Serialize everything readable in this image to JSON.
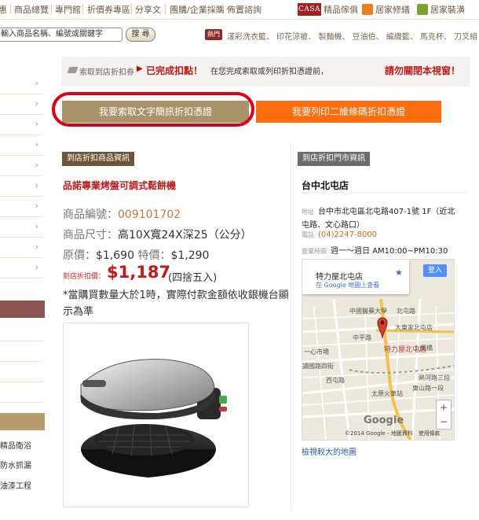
{
  "top_nav": {
    "items": [
      "惠",
      "商品總覽",
      "專門館",
      "折價券專區",
      "分享文",
      "團購/企業採購",
      "佈置諮詢"
    ],
    "right_links": [
      {
        "badge": "CASA",
        "label": "精品傢俱"
      },
      {
        "label": "居家修繕",
        "color": "#f07c1a"
      },
      {
        "label": "居家裝潢",
        "color": "#7aa332"
      }
    ]
  },
  "search": {
    "placeholder": "輸入商品名稱、編號或關鍵字",
    "button_label": "搜 尋",
    "hot_badge": "熱門",
    "hot_links": "漾彩洗衣籃、 印花涼被、 製麵機、 豆油伯、 編織籃、 馬克杯、 刀叉組"
  },
  "sidebar": {
    "bottom_items": [
      "精品衛浴",
      "防水抓漏",
      "油漆工程"
    ]
  },
  "banner": {
    "step_label": "索取到店折扣券",
    "status": "已完成扣點！",
    "note": "在您完成索取或列印折扣憑證前，",
    "warning": "請勿關閉本視窗！"
  },
  "actions": {
    "text_voucher": "我要索取文字簡訊折扣憑證",
    "barcode_voucher": "我要列印二維條碼折扣憑證"
  },
  "product": {
    "section_tag": "到店折扣商品資訊",
    "name": "品諾專業烤盤可調式鬆餅機",
    "code_label": "商品編號：",
    "code_value": "009101702",
    "size_label": "商品尺寸：",
    "size_value": "高10X寬24X深25（公分）",
    "orig_label": "原價：",
    "orig_value": "$1,690",
    "special_label": "特價：",
    "special_value": "$1,290",
    "discount_label": "到店折扣價：",
    "discount_value": "$1,187",
    "discount_note": "(四捨五入)",
    "disclaimer": "*當購買數量大於1時，實際付款金額依收銀機台顯示為準"
  },
  "store": {
    "section_tag": "到店折扣門市資訊",
    "name": "台中北屯店",
    "address_label": "地址",
    "address_line1": "台中市北屯區北屯路407-1號 1F（近北",
    "address_line2": "屯路、文心路口）",
    "phone_label": "電話",
    "phone": "(04)2247-8000",
    "hours_label": "營業時間",
    "hours": "週一～週日 AM10:00~PM10:30",
    "map": {
      "card_name": "特力屋北屯店",
      "card_link": "在 Google 地圖上查看",
      "login": "登入",
      "pin_label": "特力屋北屯店",
      "labels": [
        "大東家北屯店",
        "中平路",
        "上楓橋",
        "讀國路四街",
        "西屯路",
        "熱河路三段",
        "東山路一段",
        "太原火車站",
        "一心市場",
        "北屯路",
        "中國醫藥大學"
      ],
      "logo": "Google",
      "footer": "©2014 Google - 地圖資料　使用條款",
      "zoom_in": "+",
      "zoom_out": "−"
    },
    "larger_map_link": "檢視較大的地圖"
  }
}
